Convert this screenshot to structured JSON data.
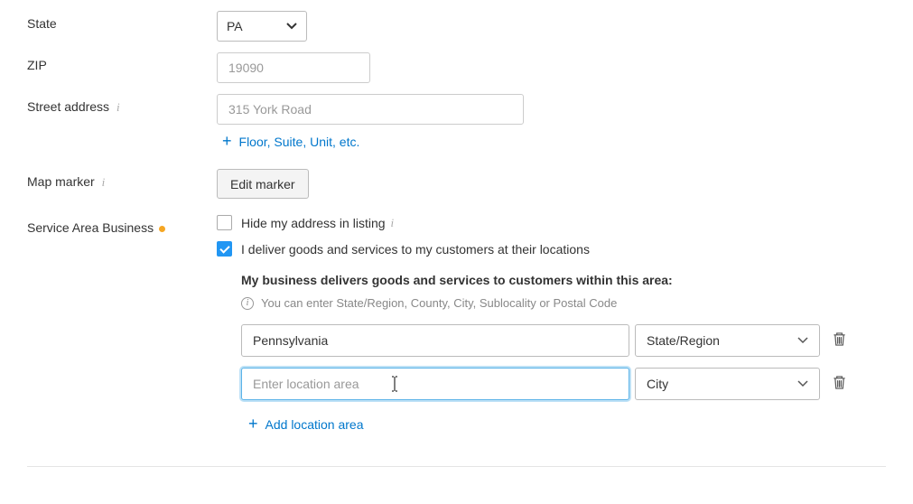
{
  "labels": {
    "state": "State",
    "zip": "ZIP",
    "street": "Street address",
    "mapMarker": "Map marker",
    "serviceArea": "Service Area Business"
  },
  "fields": {
    "stateValue": "PA",
    "zipPlaceholder": "19090",
    "streetPlaceholder": "315 York Road"
  },
  "actions": {
    "floorLink": "Floor, Suite, Unit, etc.",
    "editMarker": "Edit marker",
    "addLocation": "Add location area"
  },
  "checkboxes": {
    "hideAddress": "Hide my address in listing",
    "deliverGoods": "I deliver goods and services to my customers at their locations"
  },
  "delivery": {
    "heading": "My business delivers goods and services to customers within this area:",
    "hint": "You can enter State/Region, County, City, Sublocality or Postal Code",
    "rows": [
      {
        "value": "Pennsylvania",
        "type": "State/Region"
      },
      {
        "value": "",
        "placeholder": "Enter location area",
        "type": "City"
      }
    ]
  }
}
